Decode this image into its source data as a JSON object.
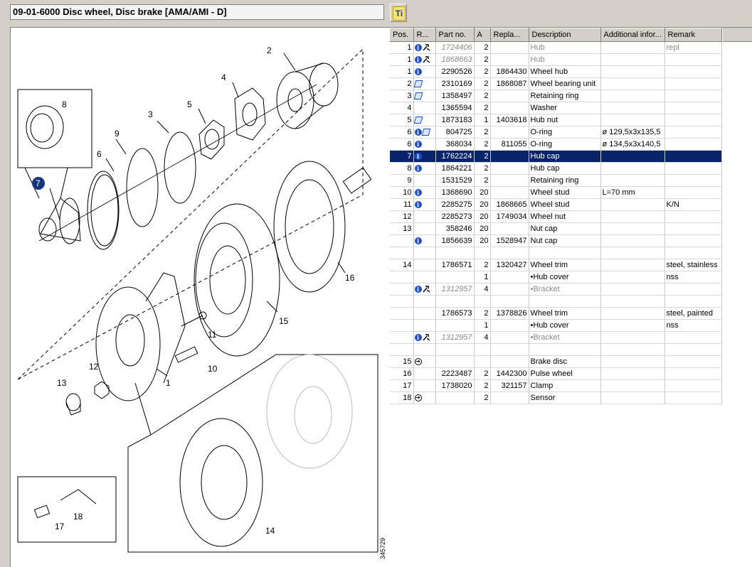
{
  "window": {
    "title": "09-01-6000 Disc wheel, Disc brake [AMA/AMI - D]",
    "ti_button_label": "Ti"
  },
  "diagram": {
    "image_id": "345729",
    "callouts": [
      "1",
      "2",
      "3",
      "4",
      "5",
      "6",
      "7",
      "8",
      "9",
      "10",
      "11",
      "12",
      "13",
      "14",
      "15",
      "16",
      "17",
      "18"
    ]
  },
  "table": {
    "columns": [
      "Pos.",
      "R...",
      "Part no.",
      "A",
      "Repla...",
      "Description",
      "Additional infor...",
      "Remark"
    ],
    "rows": [
      {
        "pos": "1",
        "icons": [
          "info",
          "tool"
        ],
        "part": "1724406",
        "a": "2",
        "repl": "",
        "desc": "Hub",
        "add": "",
        "remark": "repl",
        "dim": true,
        "sel": false
      },
      {
        "pos": "1",
        "icons": [
          "info",
          "tool"
        ],
        "part": "1868663",
        "a": "2",
        "repl": "",
        "desc": "Hub",
        "add": "",
        "remark": "",
        "dim": true,
        "sel": false
      },
      {
        "pos": "1",
        "icons": [
          "info"
        ],
        "part": "2290526",
        "a": "2",
        "repl": "1864430",
        "desc": "Wheel hub",
        "add": "",
        "remark": "",
        "dim": false,
        "sel": false
      },
      {
        "pos": "2",
        "icons": [
          "repl"
        ],
        "part": "2310169",
        "a": "2",
        "repl": "1868087",
        "desc": "Wheel bearing unit",
        "add": "",
        "remark": "",
        "dim": false,
        "sel": false
      },
      {
        "pos": "3",
        "icons": [
          "repl"
        ],
        "part": "1358497",
        "a": "2",
        "repl": "",
        "desc": "Retaining ring",
        "add": "",
        "remark": "",
        "dim": false,
        "sel": false
      },
      {
        "pos": "4",
        "icons": [],
        "part": "1365594",
        "a": "2",
        "repl": "",
        "desc": "Washer",
        "add": "",
        "remark": "",
        "dim": false,
        "sel": false
      },
      {
        "pos": "5",
        "icons": [
          "repl"
        ],
        "part": "1873183",
        "a": "1",
        "repl": "1403618",
        "desc": "Hub nut",
        "add": "",
        "remark": "",
        "dim": false,
        "sel": false
      },
      {
        "pos": "6",
        "icons": [
          "info",
          "repl"
        ],
        "part": "804725",
        "a": "2",
        "repl": "",
        "desc": "O-ring",
        "add": "ø 129,5x3x135,5",
        "remark": "",
        "dim": false,
        "sel": false
      },
      {
        "pos": "6",
        "icons": [
          "info"
        ],
        "part": "368034",
        "a": "2",
        "repl": "811055",
        "desc": "O-ring",
        "add": "ø 134,5x3x140,5",
        "remark": "",
        "dim": false,
        "sel": false
      },
      {
        "pos": "7",
        "icons": [
          "info"
        ],
        "part": "1762224",
        "a": "2",
        "repl": "",
        "desc": "Hub cap",
        "add": "",
        "remark": "",
        "dim": false,
        "sel": true
      },
      {
        "pos": "8",
        "icons": [
          "info"
        ],
        "part": "1864221",
        "a": "2",
        "repl": "",
        "desc": "Hub cap",
        "add": "",
        "remark": "",
        "dim": false,
        "sel": false
      },
      {
        "pos": "9",
        "icons": [],
        "part": "1531529",
        "a": "2",
        "repl": "",
        "desc": "Retaining ring",
        "add": "",
        "remark": "",
        "dim": false,
        "sel": false
      },
      {
        "pos": "10",
        "icons": [
          "info"
        ],
        "part": "1368690",
        "a": "20",
        "repl": "",
        "desc": "Wheel stud",
        "add": "L=70 mm",
        "remark": "",
        "dim": false,
        "sel": false
      },
      {
        "pos": "11",
        "icons": [
          "info"
        ],
        "part": "2285275",
        "a": "20",
        "repl": "1868665",
        "desc": "Wheel stud",
        "add": "",
        "remark": "K/N",
        "dim": false,
        "sel": false
      },
      {
        "pos": "12",
        "icons": [],
        "part": "2285273",
        "a": "20",
        "repl": "1749034",
        "desc": "Wheel nut",
        "add": "",
        "remark": "",
        "dim": false,
        "sel": false
      },
      {
        "pos": "13",
        "icons": [],
        "part": "358246",
        "a": "20",
        "repl": "",
        "desc": "Nut cap",
        "add": "",
        "remark": "",
        "dim": false,
        "sel": false
      },
      {
        "pos": "",
        "icons": [
          "info"
        ],
        "part": "1856639",
        "a": "20",
        "repl": "1528947",
        "desc": "Nut cap",
        "add": "",
        "remark": "",
        "dim": false,
        "sel": false
      },
      {
        "pos": "",
        "icons": [],
        "part": "",
        "a": "",
        "repl": "",
        "desc": "",
        "add": "",
        "remark": "",
        "dim": false,
        "sel": false
      },
      {
        "pos": "14",
        "icons": [],
        "part": "1786571",
        "a": "2",
        "repl": "1320427",
        "desc": "Wheel trim",
        "add": "",
        "remark": "steel, stainless",
        "dim": false,
        "sel": false
      },
      {
        "pos": "",
        "icons": [],
        "part": "",
        "a": "1",
        "repl": "",
        "desc": "•Hub cover",
        "add": "",
        "remark": "nss",
        "dim": false,
        "sel": false
      },
      {
        "pos": "",
        "icons": [
          "info",
          "tool"
        ],
        "part": "1312957",
        "a": "4",
        "repl": "",
        "desc": "•Bracket",
        "add": "",
        "remark": "",
        "dim": true,
        "sel": false
      },
      {
        "pos": "",
        "icons": [],
        "part": "",
        "a": "",
        "repl": "",
        "desc": "",
        "add": "",
        "remark": "",
        "dim": false,
        "sel": false
      },
      {
        "pos": "",
        "icons": [],
        "part": "1786573",
        "a": "2",
        "repl": "1378826",
        "desc": "Wheel trim",
        "add": "",
        "remark": "steel, painted",
        "dim": false,
        "sel": false
      },
      {
        "pos": "",
        "icons": [],
        "part": "",
        "a": "1",
        "repl": "",
        "desc": "•Hub cover",
        "add": "",
        "remark": "nss",
        "dim": false,
        "sel": false
      },
      {
        "pos": "",
        "icons": [
          "info",
          "tool"
        ],
        "part": "1312957",
        "a": "4",
        "repl": "",
        "desc": "•Bracket",
        "add": "",
        "remark": "",
        "dim": true,
        "sel": false
      },
      {
        "pos": "",
        "icons": [],
        "part": "",
        "a": "",
        "repl": "",
        "desc": "",
        "add": "",
        "remark": "",
        "dim": false,
        "sel": false
      },
      {
        "pos": "15",
        "icons": [
          "arrow"
        ],
        "part": "",
        "a": "",
        "repl": "",
        "desc": "Brake disc",
        "add": "",
        "remark": "",
        "dim": false,
        "sel": false
      },
      {
        "pos": "16",
        "icons": [],
        "part": "2223487",
        "a": "2",
        "repl": "1442300",
        "desc": "Pulse wheel",
        "add": "",
        "remark": "",
        "dim": false,
        "sel": false
      },
      {
        "pos": "17",
        "icons": [],
        "part": "1738020",
        "a": "2",
        "repl": "321157",
        "desc": "Clamp",
        "add": "",
        "remark": "",
        "dim": false,
        "sel": false
      },
      {
        "pos": "18",
        "icons": [
          "arrow"
        ],
        "part": "",
        "a": "2",
        "repl": "",
        "desc": "Sensor",
        "add": "",
        "remark": "",
        "dim": false,
        "sel": false
      }
    ]
  }
}
